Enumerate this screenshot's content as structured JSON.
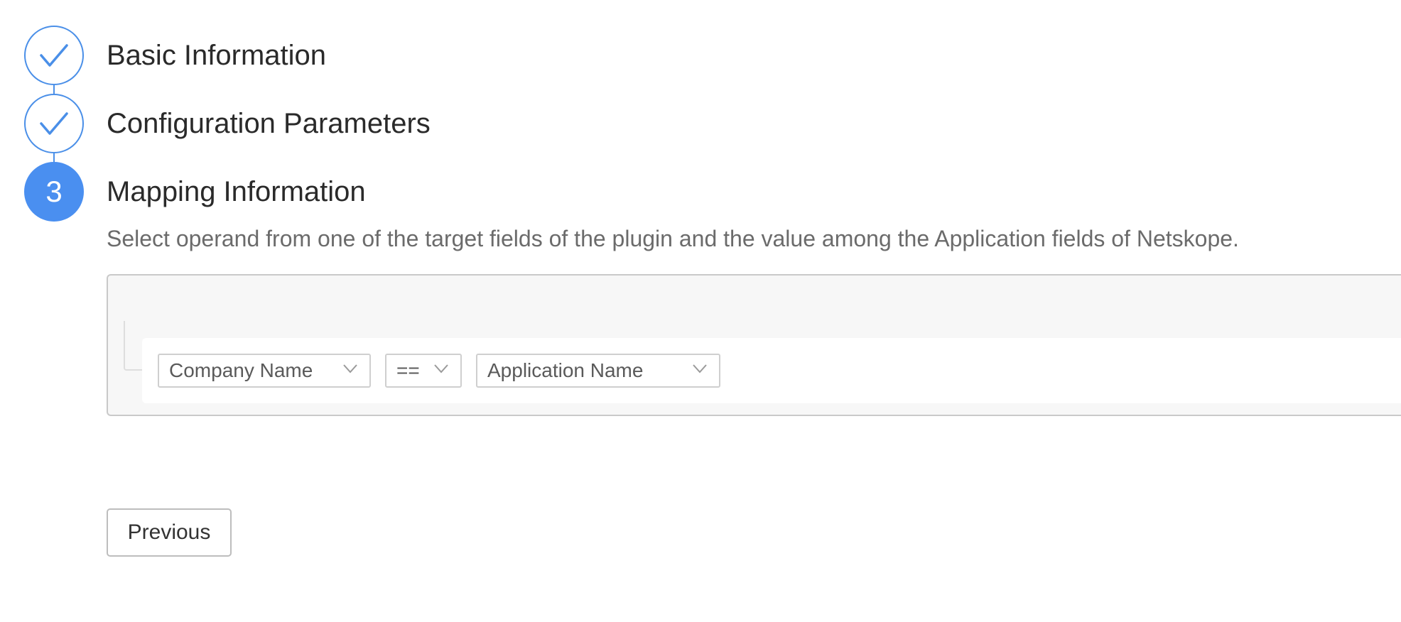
{
  "steps": [
    {
      "label": "Basic Information",
      "status": "completed",
      "icon": "check-icon"
    },
    {
      "label": "Configuration Parameters",
      "status": "completed",
      "icon": "check-icon"
    },
    {
      "label": "Mapping Information",
      "status": "active",
      "number": "3"
    }
  ],
  "mapping": {
    "description": "Select operand from one of the target fields of the plugin and the value among the Application fields of Netskope.",
    "rule": {
      "field": "Company Name",
      "operator": "==",
      "value": "Application Name"
    }
  },
  "actions": {
    "previous_label": "Previous"
  },
  "colors": {
    "accent": "#4a8ff0",
    "border": "#c9c9c9",
    "panel_bg": "#f7f7f7"
  }
}
